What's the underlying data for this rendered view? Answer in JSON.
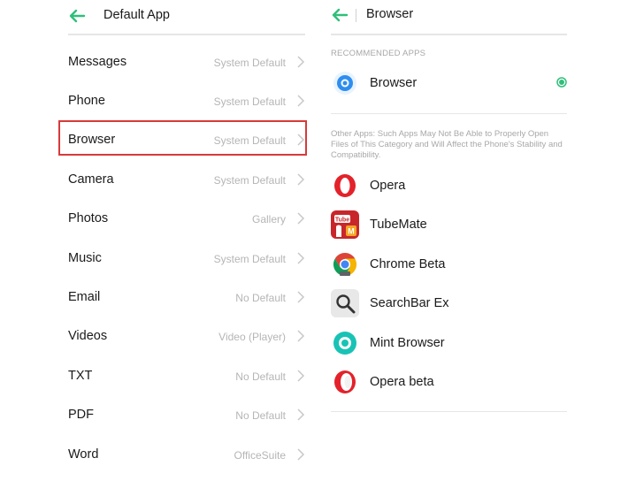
{
  "left_panel": {
    "title": "Default App",
    "rows": [
      {
        "label": "Messages",
        "value": "System Default"
      },
      {
        "label": "Phone",
        "value": "System Default"
      },
      {
        "label": "Browser",
        "value": "System Default"
      },
      {
        "label": "Camera",
        "value": "System Default"
      },
      {
        "label": "Photos",
        "value": "Gallery"
      },
      {
        "label": "Music",
        "value": "System Default"
      },
      {
        "label": "Email",
        "value": "No Default"
      },
      {
        "label": "Videos",
        "value": "Video (Player)"
      },
      {
        "label": "TXT",
        "value": "No Default"
      },
      {
        "label": "PDF",
        "value": "No Default"
      },
      {
        "label": "Word",
        "value": "OfficeSuite"
      }
    ],
    "highlighted_row": "Browser"
  },
  "right_panel": {
    "title": "Browser",
    "recommended_header": "RECOMMENDED APPS",
    "recommended_app": {
      "name": "Browser",
      "icon": "browser-icon",
      "selected": true
    },
    "other_note": "Other Apps: Such Apps May Not Be Able to Properly Open Files of This Category and Will Affect the Phone's Stability and Compatibility.",
    "other_apps": [
      {
        "name": "Opera",
        "icon": "opera-icon"
      },
      {
        "name": "TubeMate",
        "icon": "tubemate-icon"
      },
      {
        "name": "Chrome Beta",
        "icon": "chrome-beta-icon"
      },
      {
        "name": "SearchBar Ex",
        "icon": "search-icon"
      },
      {
        "name": "Mint Browser",
        "icon": "mint-browser-icon"
      },
      {
        "name": "Opera beta",
        "icon": "opera-beta-icon"
      }
    ]
  },
  "colors": {
    "accent_green": "#2fbf7a",
    "highlight_red": "#d83a3a",
    "muted_text": "#b5b5b5"
  }
}
